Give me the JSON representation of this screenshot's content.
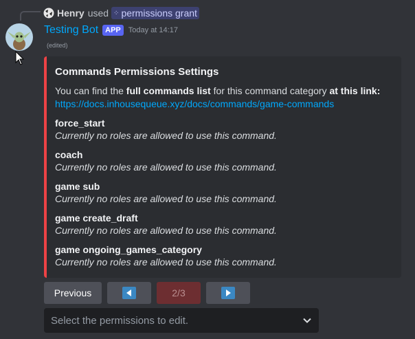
{
  "reply": {
    "user": "Henry",
    "used": "used",
    "command": "permissions grant"
  },
  "message": {
    "author": "Testing Bot",
    "badge": "APP",
    "timestamp": "Today at 14:17",
    "edited": "(edited)"
  },
  "embed": {
    "accent_color": "#ed4245",
    "title": "Commands Permissions Settings",
    "description_prefix": "You can find the ",
    "description_bold1": "full commands list",
    "description_mid": " for this command category ",
    "description_bold2": "at this link:",
    "link": "https://docs.inhousequeue.xyz/docs/commands/game-commands",
    "fields": [
      {
        "name": "force_start",
        "value": "Currently no roles are allowed to use this command."
      },
      {
        "name": "coach",
        "value": "Currently no roles are allowed to use this command."
      },
      {
        "name": "game sub",
        "value": "Currently no roles are allowed to use this command."
      },
      {
        "name": "game create_draft",
        "value": "Currently no roles are allowed to use this command."
      },
      {
        "name": "game ongoing_games_category",
        "value": "Currently no roles are allowed to use this command."
      }
    ]
  },
  "buttons": {
    "previous": "Previous",
    "left_icon": "left-arrow-icon",
    "page": "2/3",
    "right_icon": "right-arrow-icon"
  },
  "select": {
    "placeholder": "Select the permissions to edit.",
    "icon": "chevron-down-icon"
  }
}
